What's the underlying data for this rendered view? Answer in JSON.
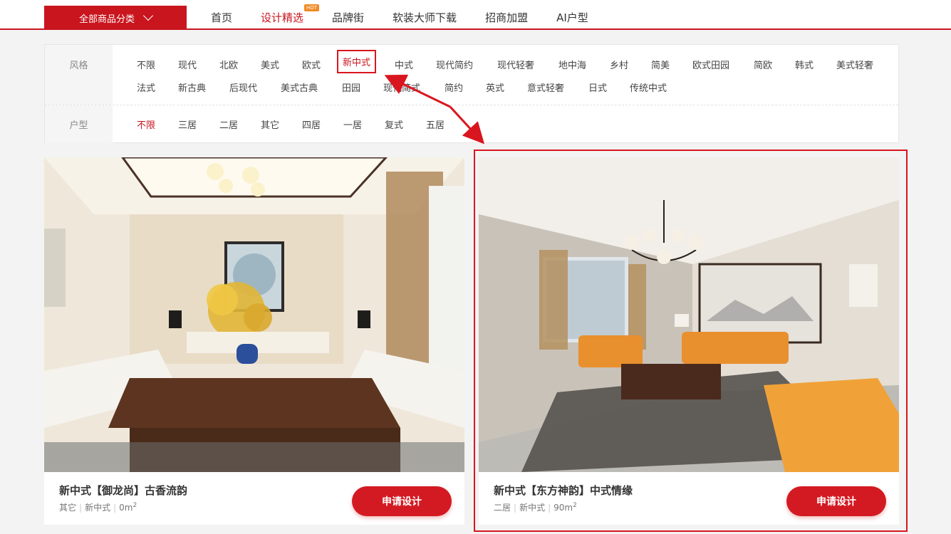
{
  "header": {
    "category_button": "全部商品分类",
    "nav": [
      {
        "label": "首页",
        "active": false
      },
      {
        "label": "设计精选",
        "active": true,
        "badge": "HOT"
      },
      {
        "label": "品牌街",
        "active": false
      },
      {
        "label": "软装大师下载",
        "active": false
      },
      {
        "label": "招商加盟",
        "active": false
      },
      {
        "label": "AI户型",
        "active": false
      }
    ]
  },
  "filters": {
    "style": {
      "label": "风格",
      "options": [
        "不限",
        "现代",
        "北欧",
        "美式",
        "欧式",
        "新中式",
        "中式",
        "现代简约",
        "现代轻奢",
        "地中海",
        "乡村",
        "简美",
        "欧式田园",
        "简欧",
        "韩式",
        "美式轻奢",
        "法式",
        "新古典",
        "后现代",
        "美式古典",
        "田园",
        "现代简式",
        "简约",
        "英式",
        "意式轻奢",
        "日式",
        "传统中式"
      ],
      "selected": "新中式"
    },
    "layout": {
      "label": "户型",
      "options": [
        "不限",
        "三居",
        "二居",
        "其它",
        "四居",
        "一居",
        "复式",
        "五居"
      ],
      "selected": "不限"
    }
  },
  "cards": [
    {
      "title": "新中式【御龙尚】古香流韵",
      "meta": [
        "其它",
        "新中式",
        "0m"
      ],
      "unit_sup": "2",
      "button": "申请设计"
    },
    {
      "title": "新中式【东方神韵】中式情缘",
      "meta": [
        "二居",
        "新中式",
        "90m"
      ],
      "unit_sup": "2",
      "button": "申请设计"
    }
  ],
  "colors": {
    "brand": "#c9151e",
    "annotation": "#d9161f",
    "hot_badge": "#f08a24"
  }
}
